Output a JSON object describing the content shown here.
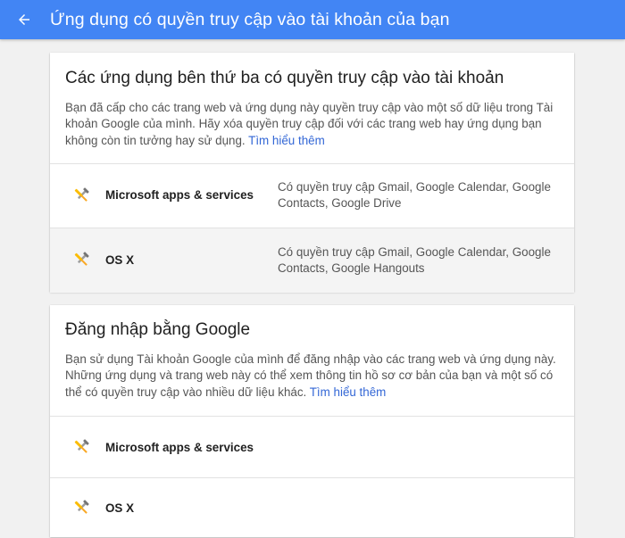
{
  "header": {
    "title": "Ứng dụng có quyền truy cập vào tài khoản của bạn",
    "background": "#4285f4"
  },
  "third_party": {
    "title": "Các ứng dụng bên thứ ba có quyền truy cập vào tài khoản",
    "description": "Bạn đã cấp cho các trang web và ứng dụng này quyền truy cập vào một số dữ liệu trong Tài khoản Google của mình. Hãy xóa quyền truy cập đối với các trang web hay ứng dụng bạn không còn tin tưởng hay sử dụng.",
    "learn_more": "Tìm hiểu thêm",
    "apps": [
      {
        "name": "Microsoft apps & services",
        "access": "Có quyền truy cập Gmail, Google Calendar, Google Contacts, Google Drive",
        "icon": "tools-icon"
      },
      {
        "name": "OS X",
        "access": "Có quyền truy cập Gmail, Google Calendar, Google Contacts, Google Hangouts",
        "icon": "tools-icon"
      }
    ]
  },
  "google_signin": {
    "title": "Đăng nhập bằng Google",
    "description": "Bạn sử dụng Tài khoản Google của mình để đăng nhập vào các trang web và ứng dụng này. Những ứng dụng và trang web này có thể xem thông tin hồ sơ cơ bản của bạn và một số có thể có quyền truy cập vào nhiều dữ liệu khác.",
    "learn_more": "Tìm hiểu thêm",
    "apps": [
      {
        "name": "Microsoft apps & services",
        "icon": "tools-icon"
      },
      {
        "name": "OS X",
        "icon": "tools-icon"
      }
    ]
  }
}
